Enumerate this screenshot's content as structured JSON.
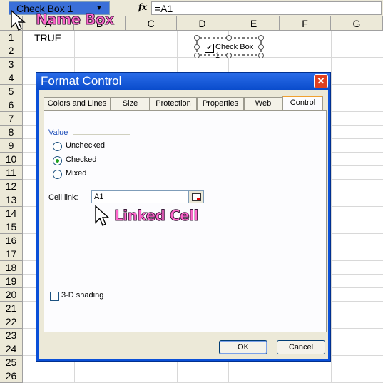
{
  "formula_bar": {
    "name_box": "Check Box 1",
    "fx": "fx",
    "formula": "=A1"
  },
  "grid": {
    "columns": [
      "A",
      "B",
      "C",
      "D",
      "E",
      "F",
      "G"
    ],
    "rows": [
      "1",
      "2",
      "3",
      "4",
      "5",
      "6",
      "7",
      "8",
      "9",
      "10",
      "11",
      "12",
      "13",
      "14",
      "15",
      "16",
      "17",
      "18",
      "19",
      "20",
      "21",
      "22",
      "23",
      "24",
      "25",
      "26"
    ],
    "cell_A1": "TRUE"
  },
  "checkbox_control": {
    "label": "Check Box 1",
    "checked_glyph": "✔"
  },
  "dialog": {
    "title": "Format Control",
    "close_glyph": "✕",
    "tabs": [
      "Colors and Lines",
      "Size",
      "Protection",
      "Properties",
      "Web",
      "Control"
    ],
    "active_tab": "Control",
    "value_group": "Value",
    "options": [
      "Unchecked",
      "Checked",
      "Mixed"
    ],
    "selected_option": "Checked",
    "cell_link_label": "Cell link:",
    "cell_link_value": "A1",
    "shading_label": "3-D shading",
    "ok": "OK",
    "cancel": "Cancel"
  },
  "annotations": {
    "name_box": "Name Box",
    "linked_cell": "Linked Cell"
  },
  "colors": {
    "annotation": "#ff66cc",
    "titlebar": "#0a4ccc",
    "selection": "#3a6fd8"
  }
}
